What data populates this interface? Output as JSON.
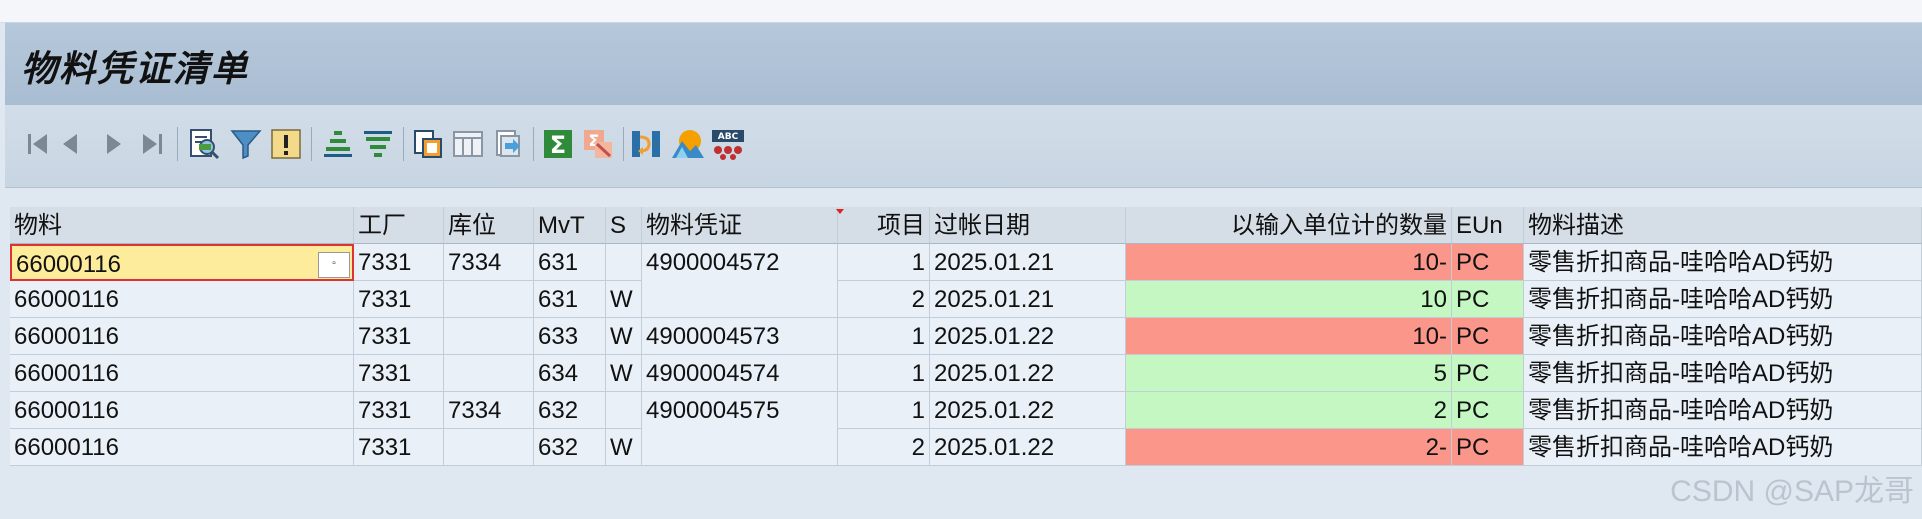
{
  "window": {
    "title": "物料凭证清单"
  },
  "toolbar": {
    "buttons": [
      {
        "name": "first-page-icon"
      },
      {
        "name": "prev-page-icon"
      },
      {
        "name": "next-page-icon"
      },
      {
        "name": "last-page-icon"
      },
      {
        "name": "details-icon"
      },
      {
        "name": "filter-icon"
      },
      {
        "name": "exception-icon"
      },
      {
        "name": "sort-ascending-icon"
      },
      {
        "name": "sort-descending-icon"
      },
      {
        "name": "select-layout-icon"
      },
      {
        "name": "change-layout-icon"
      },
      {
        "name": "export-icon"
      },
      {
        "name": "sum-icon"
      },
      {
        "name": "subtotal-icon"
      },
      {
        "name": "print-preview-icon"
      },
      {
        "name": "graphic-icon"
      },
      {
        "name": "abc-analysis-icon"
      }
    ]
  },
  "table": {
    "headers": {
      "material": "物料",
      "plant": "工厂",
      "sloc": "库位",
      "mvt": "MvT",
      "s": "S",
      "doc": "物料凭证",
      "item": "项目",
      "date": "过帐日期",
      "qty": "以输入单位计的数量",
      "eun": "EUn",
      "desc": "物料描述"
    },
    "rows": [
      {
        "material": "66000116",
        "plant": "7331",
        "sloc": "7334",
        "mvt": "631",
        "s": "",
        "doc": "4900004572",
        "item": "1",
        "date": "2025.01.21",
        "qty": "10-",
        "eun": "PC",
        "desc": "零售折扣商品-哇哈哈AD钙奶",
        "sign": "neg"
      },
      {
        "material": "66000116",
        "plant": "7331",
        "sloc": "",
        "mvt": "631",
        "s": "W",
        "doc": "",
        "item": "2",
        "date": "2025.01.21",
        "qty": "10",
        "eun": "PC",
        "desc": "零售折扣商品-哇哈哈AD钙奶",
        "sign": "pos"
      },
      {
        "material": "66000116",
        "plant": "7331",
        "sloc": "",
        "mvt": "633",
        "s": "W",
        "doc": "4900004573",
        "item": "1",
        "date": "2025.01.22",
        "qty": "10-",
        "eun": "PC",
        "desc": "零售折扣商品-哇哈哈AD钙奶",
        "sign": "neg"
      },
      {
        "material": "66000116",
        "plant": "7331",
        "sloc": "",
        "mvt": "634",
        "s": "W",
        "doc": "4900004574",
        "item": "1",
        "date": "2025.01.22",
        "qty": "5",
        "eun": "PC",
        "desc": "零售折扣商品-哇哈哈AD钙奶",
        "sign": "pos"
      },
      {
        "material": "66000116",
        "plant": "7331",
        "sloc": "7334",
        "mvt": "632",
        "s": "",
        "doc": "4900004575",
        "item": "1",
        "date": "2025.01.22",
        "qty": "2",
        "eun": "PC",
        "desc": "零售折扣商品-哇哈哈AD钙奶",
        "sign": "pos"
      },
      {
        "material": "66000116",
        "plant": "7331",
        "sloc": "",
        "mvt": "632",
        "s": "W",
        "doc": "",
        "item": "2",
        "date": "2025.01.22",
        "qty": "2-",
        "eun": "PC",
        "desc": "零售折扣商品-哇哈哈AD钙奶",
        "sign": "neg"
      }
    ]
  },
  "colors": {
    "negative": "#fb968b",
    "positive": "#c5f7c2",
    "selected": "#fdec9c"
  },
  "watermark": "CSDN @SAP龙哥"
}
